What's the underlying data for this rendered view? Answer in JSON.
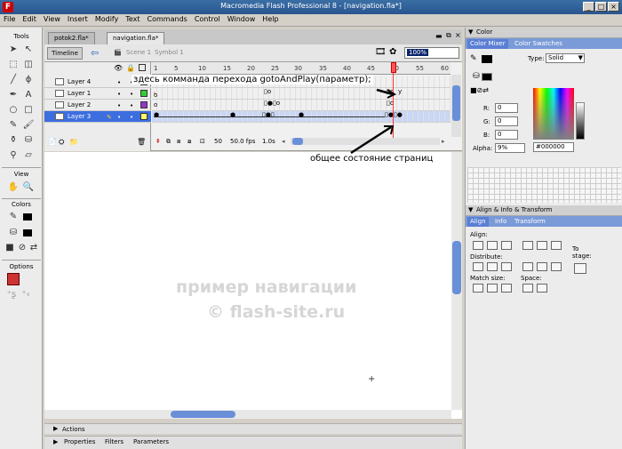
{
  "window": {
    "title": "Macromedia Flash Professional 8 - [navigation.fla*]",
    "app_icon": "F",
    "minimize": "_",
    "maximize": "□",
    "close": "×"
  },
  "menu": [
    "File",
    "Edit",
    "View",
    "Insert",
    "Modify",
    "Text",
    "Commands",
    "Control",
    "Window",
    "Help"
  ],
  "tools": {
    "header": "Tools",
    "view_header": "View",
    "colors_header": "Colors",
    "options_header": "Options"
  },
  "doc_tabs": [
    "potok2.fla*",
    "navigation.fla*"
  ],
  "editbar": {
    "timeline_label": "Timeline",
    "scene": "Scene 1",
    "symbol": "Symbol 1",
    "zoom": "100%"
  },
  "timeline": {
    "ticks": [
      "1",
      "5",
      "10",
      "15",
      "20",
      "25",
      "30",
      "35",
      "40",
      "45",
      "50",
      "55",
      "60"
    ],
    "layers": [
      {
        "name": "Layer 4",
        "color": "#ffffff"
      },
      {
        "name": "Layer 1",
        "color": "#33cc33"
      },
      {
        "name": "Layer 2",
        "color": "#9933cc"
      },
      {
        "name": "Layer 3",
        "color": "#ffff66"
      }
    ],
    "status": {
      "frame": "50",
      "fps": "50.0 fps",
      "time": "1.0s"
    },
    "frame_label": "y"
  },
  "stage": {
    "annotation_top": "здесь комманда перехода gotoAndPlay(параметр);",
    "annotation_bottom": "общее состояние страниц",
    "watermark1": "пример навигации",
    "watermark2": "© flash-site.ru",
    "crosshair": "+"
  },
  "bottom_panels": {
    "actions": "Actions",
    "properties": "Properties",
    "filters": "Filters",
    "parameters": "Parameters"
  },
  "color_panel": {
    "title": "Color",
    "tabs": [
      "Color Mixer",
      "Color Swatches"
    ],
    "type_label": "Type:",
    "type_value": "Solid",
    "r_label": "R:",
    "r_value": "0",
    "g_label": "G:",
    "g_value": "0",
    "b_label": "B:",
    "b_value": "0",
    "alpha_label": "Alpha:",
    "alpha_value": "9%",
    "hex_value": "#000000"
  },
  "align_panel": {
    "title": "Align & Info & Transform",
    "tabs": [
      "Align",
      "Info",
      "Transform"
    ],
    "align_label": "Align:",
    "distribute_label": "Distribute:",
    "match_label": "Match size:",
    "space_label": "Space:",
    "to_stage": "To stage:"
  }
}
